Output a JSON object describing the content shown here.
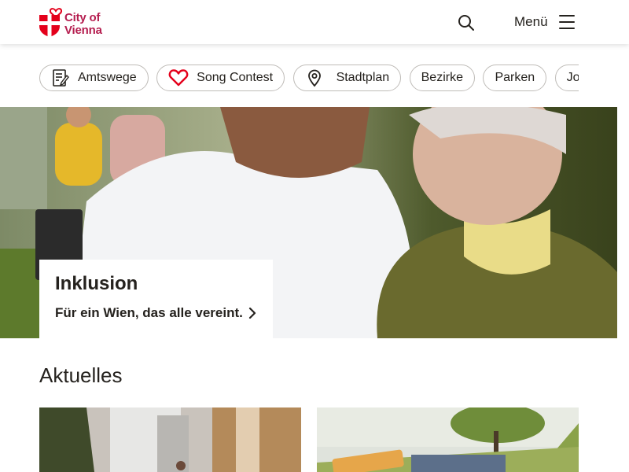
{
  "header": {
    "logo_line1": "City of",
    "logo_line2": "Vienna",
    "menu_label": "Menü",
    "search_icon": "search-icon",
    "menu_icon": "hamburger-icon"
  },
  "quick_links": [
    {
      "label": "Amtswege",
      "icon": "form-icon"
    },
    {
      "label": "Song Contest",
      "icon": "heart-icon"
    },
    {
      "label": "Stadtplan",
      "icon": "map-pin-icon"
    },
    {
      "label": "Bezirke"
    },
    {
      "label": "Parken"
    },
    {
      "label": "Jo"
    }
  ],
  "hero": {
    "title": "Inklusion",
    "link": "Für ein Wien, das alle vereint."
  },
  "news": {
    "heading": "Aktuelles"
  },
  "colors": {
    "brand": "#b51d4f",
    "shield_red": "#e4001b",
    "text": "#25221e"
  }
}
